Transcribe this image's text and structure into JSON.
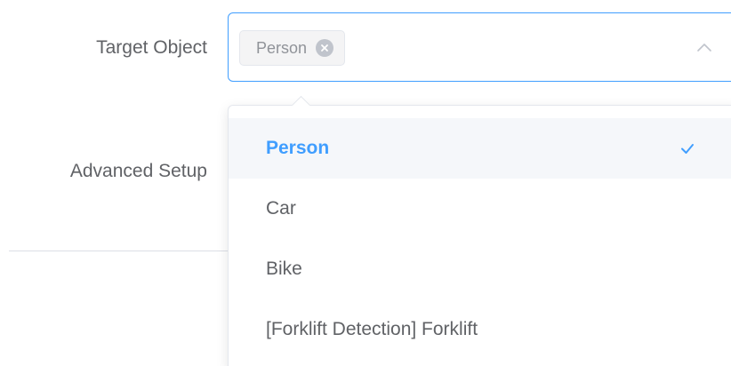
{
  "form": {
    "target_label": "Target Object",
    "advanced_label": "Advanced Setup"
  },
  "select": {
    "selected_tag": "Person",
    "options": [
      {
        "label": "Person",
        "selected": true
      },
      {
        "label": "Car",
        "selected": false
      },
      {
        "label": "Bike",
        "selected": false
      },
      {
        "label": "[Forklift Detection] Forklift",
        "selected": false
      }
    ]
  },
  "colors": {
    "accent": "#409eff",
    "text": "#606266",
    "tag_bg": "#f4f4f5",
    "hover_bg": "#f5f7fa",
    "border": "#dcdfe6"
  },
  "icons": {
    "tag_close": "close-circle-icon",
    "select_arrow": "chevron-up-icon",
    "selected_check": "check-icon"
  }
}
